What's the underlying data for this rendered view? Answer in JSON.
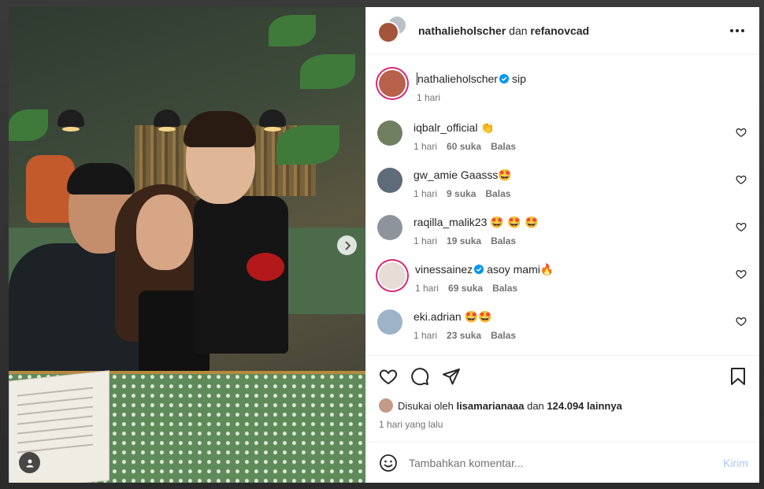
{
  "header": {
    "user1": "nathalieholscher",
    "conjunction": "dan",
    "user2": "refanovcad"
  },
  "caption": {
    "user": "nathalieholscher",
    "text": "sip",
    "time": "1 hari"
  },
  "comments": [
    {
      "user": "iqbalr_official",
      "text": "",
      "emoji": "👏",
      "time": "1 hari",
      "likes": "60 suka",
      "reply": "Balas",
      "verified": false
    },
    {
      "user": "gw_amie",
      "text": "Gaasss",
      "emoji": "🤩",
      "time": "1 hari",
      "likes": "9 suka",
      "reply": "Balas",
      "verified": false
    },
    {
      "user": "raqilla_malik23",
      "text": "",
      "emoji": "🤩 🤩 🤩",
      "time": "1 hari",
      "likes": "19 suka",
      "reply": "Balas",
      "verified": false
    },
    {
      "user": "vinessainez",
      "text": "asoy mami",
      "emoji": "🔥",
      "time": "1 hari",
      "likes": "69 suka",
      "reply": "Balas",
      "verified": true
    },
    {
      "user": "eki.adrian",
      "text": "",
      "emoji": "🤩🤩",
      "time": "1 hari",
      "likes": "23 suka",
      "reply": "Balas",
      "verified": false
    }
  ],
  "likes": {
    "prefix": "Disukai oleh",
    "user": "lisamarianaaa",
    "and": "dan",
    "count": "124.094 lainnya"
  },
  "date": "1 hari yang lalu",
  "add_comment": {
    "placeholder": "Tambahkan komentar...",
    "post_label": "Kirim"
  },
  "colors": {
    "verified": "#0095f6",
    "post_disabled": "#a7c8f5",
    "ring": "#d62976"
  }
}
